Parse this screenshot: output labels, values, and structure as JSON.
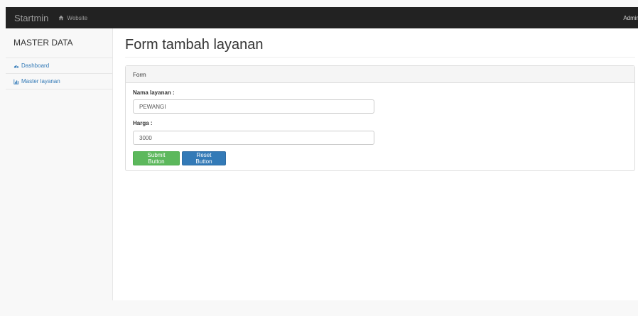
{
  "navbar": {
    "brand": "Startmin",
    "website_link": "Website",
    "admin_link": "Admin"
  },
  "sidebar": {
    "title": "MASTER DATA",
    "items": [
      {
        "label": "Dashboard",
        "icon": "dashboard-icon"
      },
      {
        "label": "Master layanan",
        "icon": "bar-chart-icon"
      }
    ]
  },
  "main": {
    "page_title": "Form tambah layanan",
    "panel": {
      "heading": "Form",
      "fields": [
        {
          "label": "Nama layanan :",
          "value": "PEWANGI"
        },
        {
          "label": "Harga :",
          "value": "3000"
        }
      ],
      "submit_label": "Submit Button",
      "reset_label": "Reset Button"
    }
  },
  "colors": {
    "navbar_bg": "#222222",
    "link": "#337ab7",
    "success": "#5cb85c",
    "primary": "#337ab7"
  }
}
